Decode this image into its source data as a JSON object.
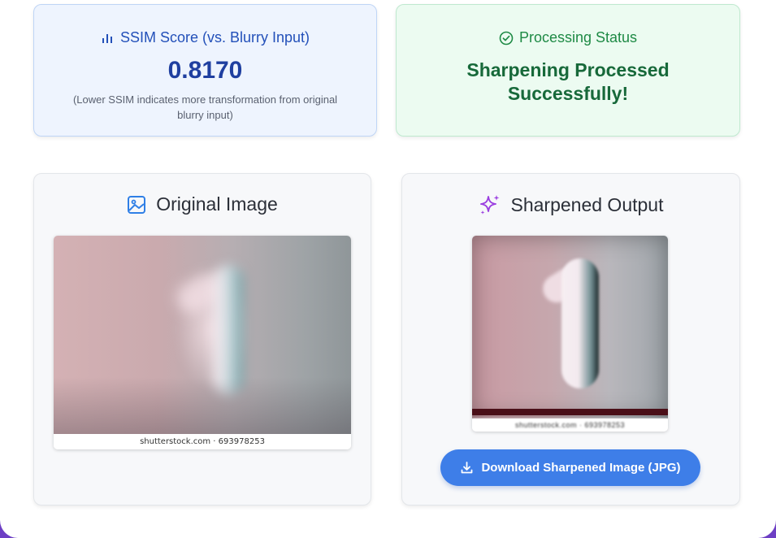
{
  "ssim_panel": {
    "title": "SSIM Score (vs. Blurry Input)",
    "value": "0.8170",
    "note": "(Lower SSIM indicates more transformation from original blurry input)",
    "icon": "bar-chart-icon",
    "accent": "#2350b9"
  },
  "status_panel": {
    "title": "Processing Status",
    "message": "Sharpening Processed Successfully!",
    "icon": "check-circle-icon",
    "accent": "#1e8a45"
  },
  "original_card": {
    "title": "Original Image",
    "icon": "image-icon",
    "caption": "shutterstock.com · 693978253"
  },
  "sharpened_card": {
    "title": "Sharpened Output",
    "icon": "sparkles-icon",
    "caption": "shutterstock.com · 693978253",
    "download_label": "Download Sharpened Image (JPG)",
    "download_icon": "download-icon"
  },
  "colors": {
    "primary_button": "#3e7ee8",
    "sparkle_purple": "#9b3fe0",
    "image_icon_blue": "#2f7fe6"
  }
}
